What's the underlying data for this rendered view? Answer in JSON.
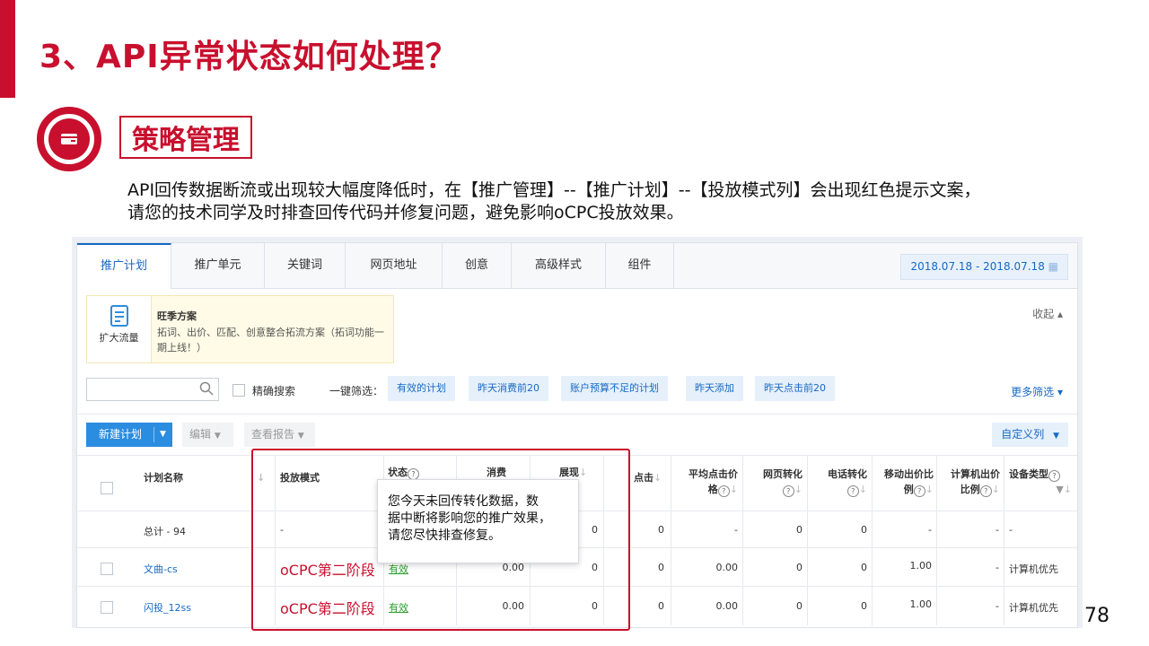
{
  "slide": {
    "title": "3、API异常状态如何处理？",
    "section": "策略管理",
    "desc_line1": "API回传数据断流或出现较大幅度降低时，在【推广管理】--【推广计划】--【投放模式列】会出现红色提示文案，",
    "desc_line2": "请您的技术同学及时排查回传代码并修复问题，避免影响oCPC投放效果。",
    "page_number": "78",
    "accent_color": "#c8102e"
  },
  "tabs": [
    "推广计划",
    "推广单元",
    "关键词",
    "网页地址",
    "创意",
    "高级样式",
    "组件"
  ],
  "date_range": "2018.07.18 - 2018.07.18",
  "recommend": {
    "icon_label": "扩大流量",
    "title": "旺季方案",
    "desc": "拓词、出价、匹配、创意整合拓流方案（拓词功能一期上线！）",
    "collapse": "收起 ▴"
  },
  "filters": {
    "search_placeholder": "",
    "precise_search": "精确搜索",
    "quick_filter_label": "一键筛选：",
    "quick_filters": [
      "有效的计划",
      "昨天消费前20",
      "账户预算不足的计划",
      "昨天添加",
      "昨天点击前20"
    ],
    "more_filters": "更多筛选 ▾"
  },
  "toolbar": {
    "new_plan": "新建计划",
    "edit": "编辑",
    "view_report": "查看报告",
    "custom_columns": "自定义列"
  },
  "table": {
    "headers": {
      "name": "计划名称",
      "mode": "投放模式",
      "status": "状态",
      "cost": "消费",
      "impressions": "展现",
      "clicks": "点击",
      "avg_click_1": "平均点击价",
      "avg_click_2": "格",
      "web_conv": "网页转化",
      "phone_conv": "电话转化",
      "mobile_bid_1": "移动出价比",
      "mobile_bid_2": "例",
      "pc_bid_1": "计算机出价",
      "pc_bid_2": "比例",
      "device": "设备类型"
    },
    "total": {
      "name": "总计 - 94",
      "mode": "-",
      "impressions": "0",
      "clicks": "0",
      "avg": "-",
      "web": "0",
      "phone": "0",
      "mobile": "-",
      "pc": "-",
      "device": "-"
    },
    "rows": [
      {
        "name": "文曲-cs",
        "mode": "oCPC第二阶段",
        "status": "有效",
        "cost": "0.00",
        "impressions": "0",
        "clicks": "0",
        "avg": "0.00",
        "web": "0",
        "phone": "0",
        "mobile": "1.00",
        "pc": "-",
        "device": "计算机优先"
      },
      {
        "name": "闪投_12ss",
        "mode": "oCPC第二阶段",
        "status": "有效",
        "cost": "0.00",
        "impressions": "0",
        "clicks": "0",
        "avg": "0.00",
        "web": "0",
        "phone": "0",
        "mobile": "1.00",
        "pc": "-",
        "device": "计算机优先"
      }
    ]
  },
  "tooltip": {
    "line1": "您今天未回传转化数据，数",
    "line2": "据中断将影响您的推广效果，",
    "line3": "请您尽快排查修复。"
  }
}
